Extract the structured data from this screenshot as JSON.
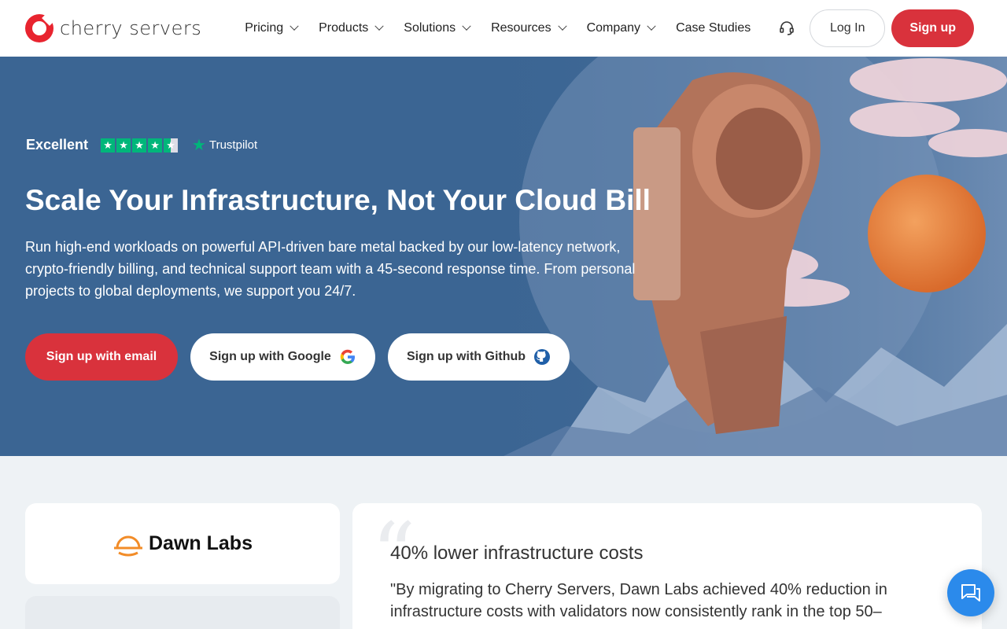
{
  "header": {
    "logo_text": "cherry servers",
    "nav": [
      {
        "label": "Pricing",
        "has_dropdown": true
      },
      {
        "label": "Products",
        "has_dropdown": true
      },
      {
        "label": "Solutions",
        "has_dropdown": true
      },
      {
        "label": "Resources",
        "has_dropdown": true
      },
      {
        "label": "Company",
        "has_dropdown": true
      },
      {
        "label": "Case Studies",
        "has_dropdown": false
      }
    ],
    "support_icon": "headset-icon",
    "login_label": "Log In",
    "signup_label": "Sign up"
  },
  "hero": {
    "rating_label": "Excellent",
    "rating_stars": 4.5,
    "trustpilot_label": "Trustpilot",
    "title": "Scale Your Infrastructure, Not Your Cloud Bill",
    "description": "Run high-end workloads on powerful API-driven bare metal backed by our low-latency network, crypto-friendly billing, and technical support team with a 45-second response time. From personal projects to global deployments, we support you 24/7.",
    "cta_email": "Sign up with email",
    "cta_google": "Sign up with Google",
    "cta_github": "Sign up with Github"
  },
  "testimonial": {
    "brand": "Dawn Labs",
    "headline": "40% lower infrastructure costs",
    "quote": "\"By migrating to Cherry Servers, Dawn Labs achieved 40% reduction in infrastructure costs with validators now consistently rank in the top 50–"
  },
  "colors": {
    "brand_red": "#d9323c",
    "hero_blue": "#3b6593",
    "trustpilot_green": "#00b67a",
    "chat_blue": "#2b8aeb"
  }
}
